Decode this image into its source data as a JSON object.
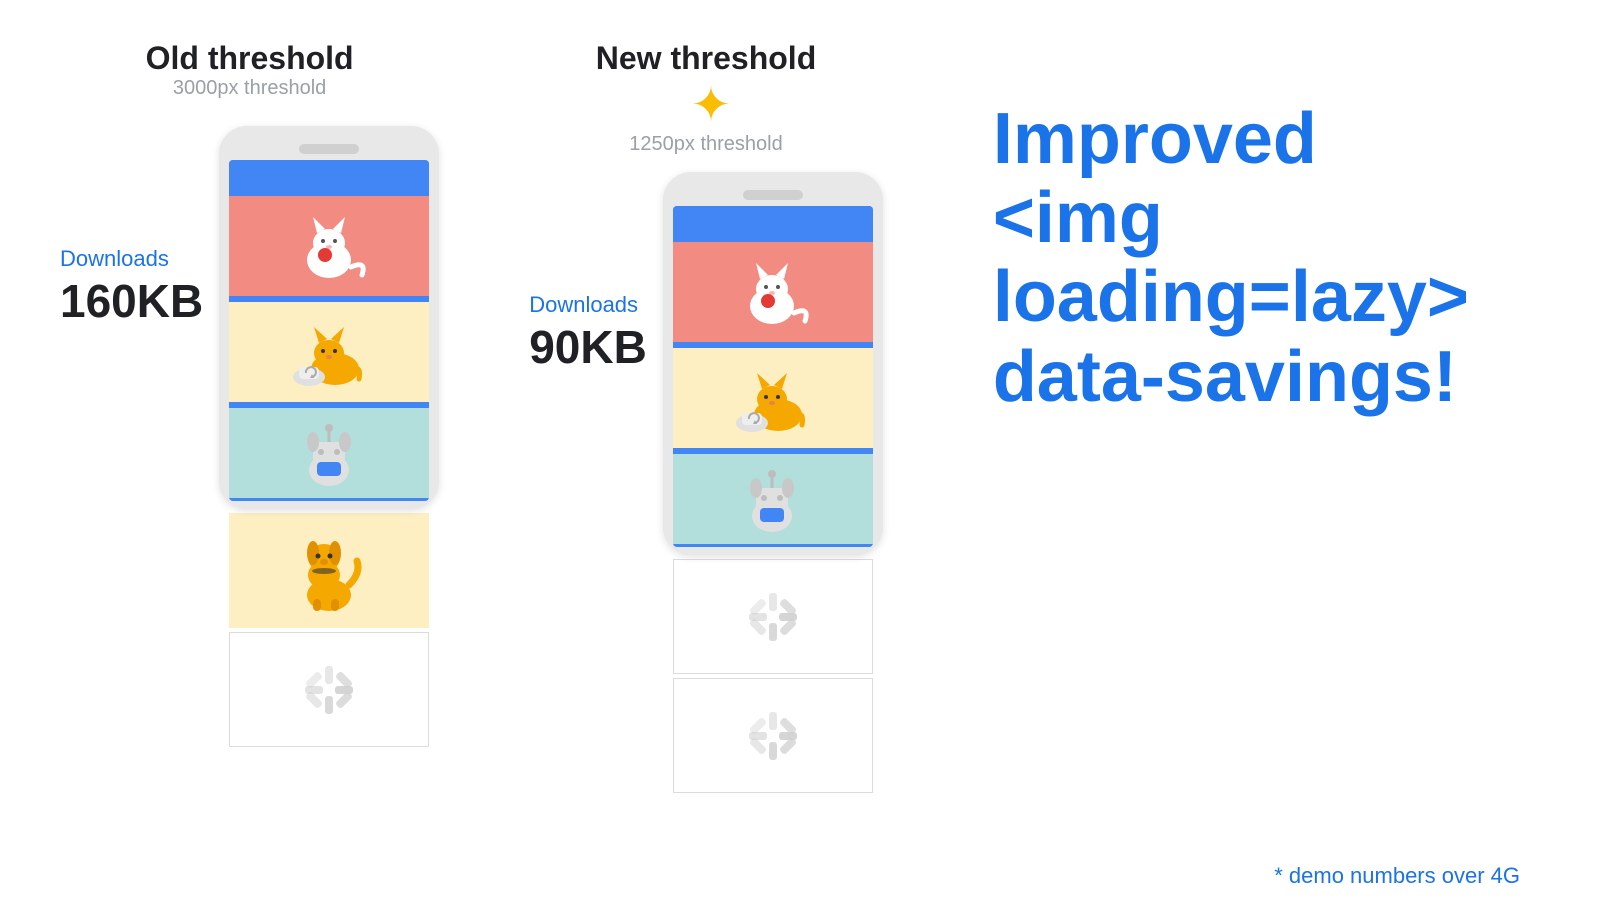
{
  "left_panel": {
    "title": "Old threshold",
    "subtitle": "3000px threshold",
    "downloads_label": "Downloads",
    "downloads_value": "160KB"
  },
  "right_panel": {
    "title": "New threshold",
    "subtitle": "1250px threshold",
    "downloads_label": "Downloads",
    "downloads_value": "90KB"
  },
  "cta": {
    "line1": "Improved",
    "line2": "<img loading=lazy>",
    "line3": "data-savings!"
  },
  "demo_note": "* demo numbers over 4G",
  "sparkle": "✦",
  "colors": {
    "blue": "#1a73e8",
    "phone_blue": "#4285f4",
    "cat1_bg": "#f28b82",
    "cat2_bg": "#feefc3",
    "dog1_bg": "#b2dfdb",
    "dog2_bg": "#feefc3",
    "loading_bg": "#ffffff",
    "loading_border": "#dadce0",
    "spinner": "#c8c8c8",
    "dark_text": "#202124",
    "gray_text": "#9aa0a6",
    "sparkle_color": "#fbbc04"
  }
}
